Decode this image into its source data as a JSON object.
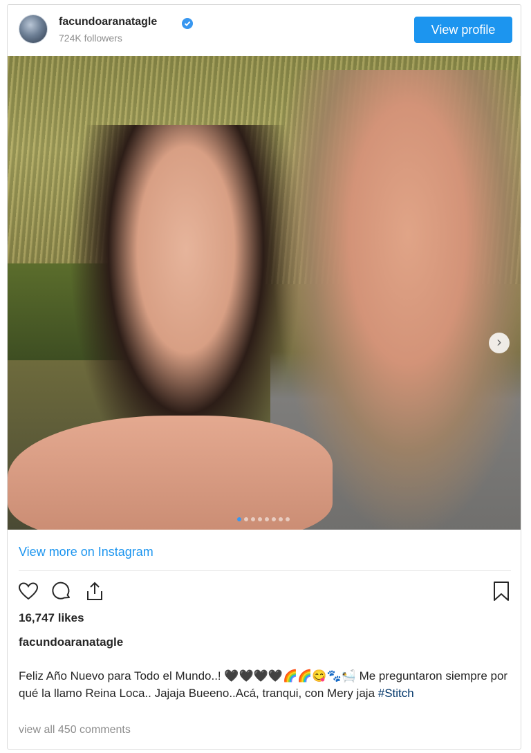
{
  "header": {
    "username": "facundoaranatagle",
    "followers": "724K followers",
    "view_profile": "View profile"
  },
  "post": {
    "view_more": "View more on Instagram",
    "likes": "16,747 likes",
    "caption_user": "facundoaranatagle",
    "caption_text": "Feliz Año Nuevo para Todo el Mundo..! 🖤🖤🖤🖤🌈🌈😋🐾🛀 Me preguntaron siempre por qué la llamo Reina Loca.. Jajaja Bueeno..Acá, tranqui, con Mery jaja ",
    "hashtag": "#Stitch",
    "view_comments": "view all 450 comments"
  },
  "carousel": {
    "next_glyph": "›",
    "slide_count": 8,
    "active_index": 0
  },
  "colors": {
    "accent": "#1c95ef",
    "verified": "#3897f0"
  },
  "icons": [
    "heart-icon",
    "comment-icon",
    "share-icon",
    "bookmark-icon",
    "verified-badge-icon",
    "chevron-right-icon"
  ]
}
